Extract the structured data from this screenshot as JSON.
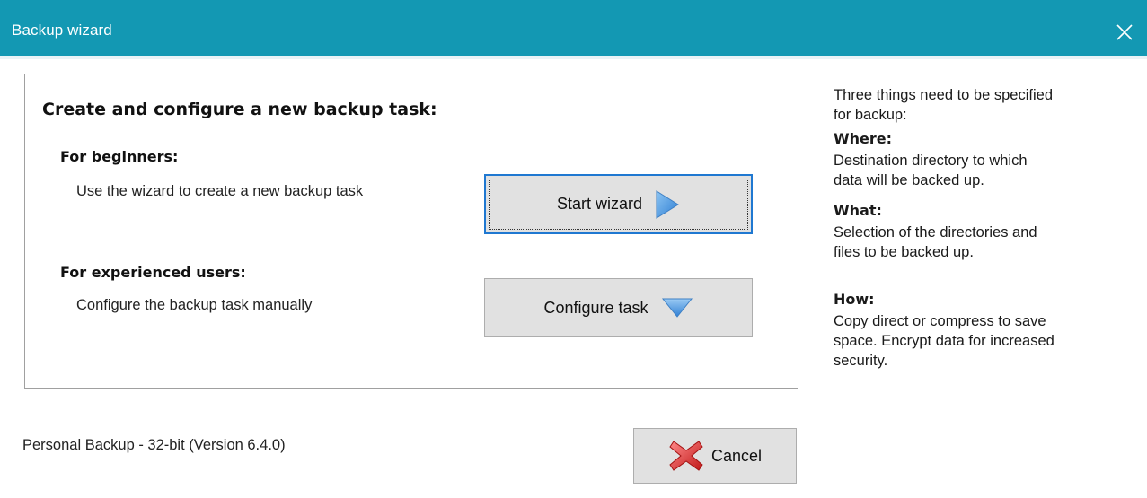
{
  "window": {
    "title": "Backup wizard",
    "close_icon": "close-icon",
    "accent_color": "#1398b3"
  },
  "main": {
    "heading": "Create and configure a new backup task:",
    "beginners": {
      "title": "For beginners:",
      "description": "Use the wizard to create a new backup task",
      "button_label": "Start wizard",
      "button_icon": "arrow-right-icon"
    },
    "experienced": {
      "title": "For experienced users:",
      "description": "Configure the backup task manually",
      "button_label": "Configure task",
      "button_icon": "arrow-down-icon"
    }
  },
  "side": {
    "intro": "Three things need to be specified\nfor backup:",
    "where_title": "Where:",
    "where_text": "Destination directory to which\ndata will be backed up.",
    "what_title": "What:",
    "what_text": "Selection of the directories and\nfiles to be backed up.",
    "how_title": "How:",
    "how_text": "Copy direct or compress to save\nspace. Encrypt data for increased\nsecurity."
  },
  "footer": {
    "version": "Personal Backup - 32-bit (Version 6.4.0)",
    "cancel_label": "Cancel",
    "cancel_icon": "red-x-icon"
  }
}
